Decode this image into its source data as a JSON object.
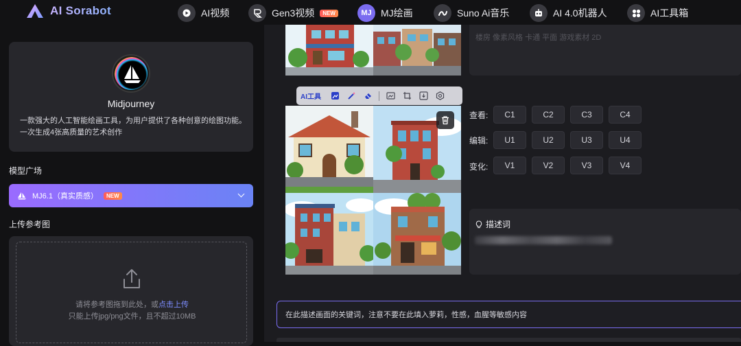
{
  "header": {
    "logo_text": "AI Sorabot",
    "nav": [
      {
        "icon": "play-icon",
        "label": "AI视频"
      },
      {
        "icon": "gen3-icon",
        "label": "Gen3视频",
        "badge": "NEW"
      },
      {
        "icon": "mj-icon",
        "icon_text": "MJ",
        "label": "MJ绘画"
      },
      {
        "icon": "music-icon",
        "label": "Suno Ai音乐"
      },
      {
        "icon": "robot-icon",
        "label": "AI 4.0机器人"
      },
      {
        "icon": "grid-icon",
        "label": "AI工具箱"
      }
    ]
  },
  "sidebar": {
    "card": {
      "name": "Midjourney",
      "description": "一款强大的人工智能绘画工具，为用户提供了各种创意的绘图功能。一次生成4张高质量的艺术创作"
    },
    "model_section_label": "模型广场",
    "model_select": {
      "value": "MJ6.1（真实质感）",
      "badge": "NEW"
    },
    "upload_section_label": "上传参考图",
    "upload": {
      "hint_prefix": "请将参考图拖到此处，或",
      "hint_link": "点击上传",
      "hint_line2": "只能上传jpg/png文件，且不超过10MB"
    }
  },
  "main": {
    "previous_prompt_text": "楼房 像素风格 卡通 平面 游戏素材 2D",
    "toolbar": {
      "ai_label": "AI工具"
    },
    "controls": [
      {
        "label": "查看:",
        "buttons": [
          "C1",
          "C2",
          "C3",
          "C4"
        ]
      },
      {
        "label": "编辑:",
        "buttons": [
          "U1",
          "U2",
          "U3",
          "U4"
        ]
      },
      {
        "label": "变化:",
        "buttons": [
          "V1",
          "V2",
          "V3",
          "V4"
        ]
      }
    ],
    "prompt_card": {
      "title": "描述词"
    },
    "input": {
      "placeholder": "在此描述画面的关键词，注意不要在此填入萝莉，性感，血腥等敏感内容"
    }
  },
  "colors": {
    "accent": "#7b6cf0",
    "background": "#121214",
    "panel": "#27272c"
  }
}
